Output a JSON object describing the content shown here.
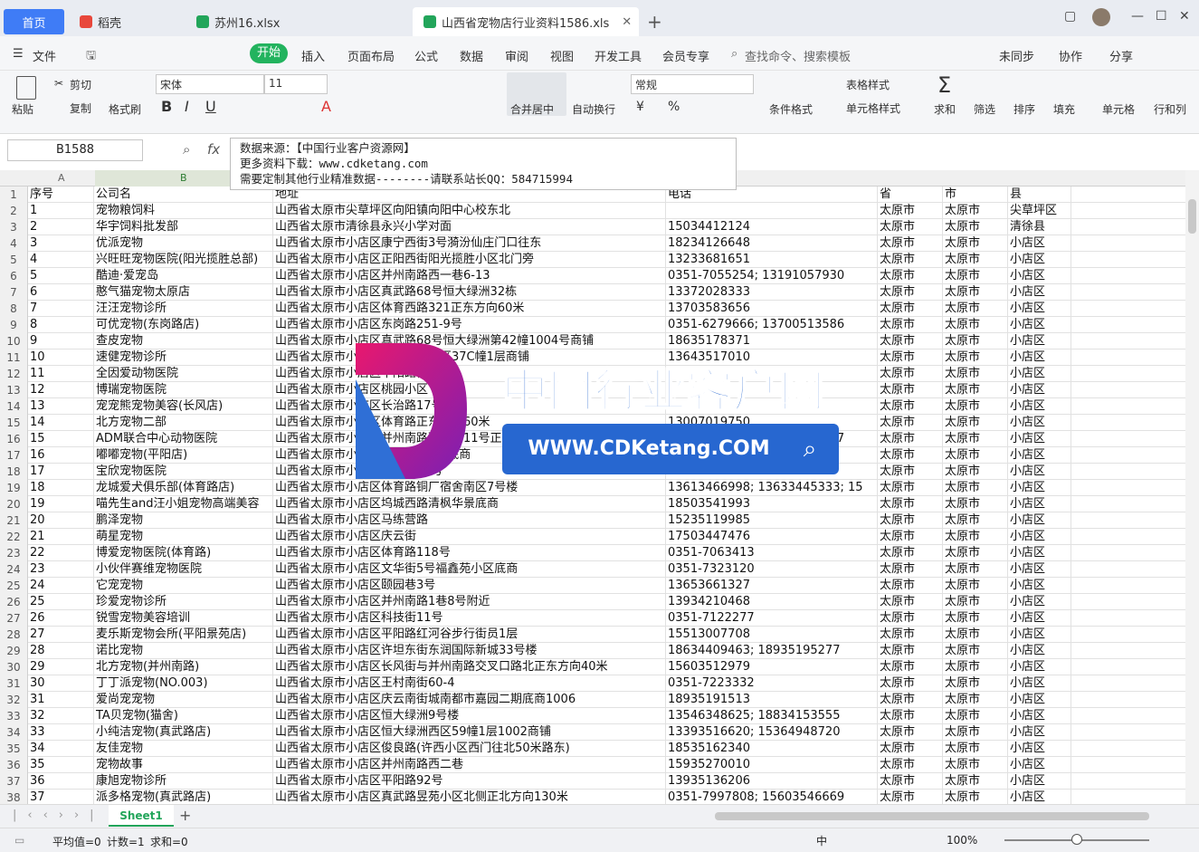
{
  "tabs": {
    "home": "首页",
    "wps": "稻壳",
    "file1": "苏州16.xlsx",
    "file2": "山西省宠物店行业资料1586.xls"
  },
  "menu": {
    "file": "文件",
    "start": "开始",
    "insert": "插入",
    "layout": "页面布局",
    "formula": "公式",
    "data": "数据",
    "review": "审阅",
    "view": "视图",
    "dev": "开发工具",
    "vip": "会员专享",
    "search": "查找命令、搜索模板",
    "sync": "未同步",
    "collab": "协作",
    "share": "分享"
  },
  "ribbon": {
    "paste": "粘贴",
    "cut": "剪切",
    "copy": "复制",
    "format_painter": "格式刷",
    "font": "宋体",
    "size": "11",
    "merge": "合并居中",
    "wrap": "自动换行",
    "numfmt": "常规",
    "cond": "条件格式",
    "tablestyle": "表格样式",
    "cellstyle": "单元格样式",
    "sum": "求和",
    "filter": "筛选",
    "sort": "排序",
    "fill": "填充",
    "cell": "单元格",
    "rowcol": "行和列"
  },
  "namebox": "B1588",
  "formula_lines": [
    "数据来源：【中国行业客户资源网】",
    "更多资料下载：www.cdketang.com",
    "需要定制其他行业精准数据--------请联系站长QQ：584715994"
  ],
  "columns": [
    "A",
    "B"
  ],
  "headers": [
    "序号",
    "公司名",
    "地址",
    "电话",
    "省",
    "市",
    "县"
  ],
  "rows": [
    [
      "1",
      "宠物粮饲料",
      "山西省太原市尖草坪区向阳镇向阳中心校东北",
      "",
      "太原市",
      "太原市",
      "尖草坪区"
    ],
    [
      "2",
      "华宇饲料批发部",
      "山西省太原市清徐县永兴小学对面",
      "15034412124",
      "太原市",
      "太原市",
      "清徐县"
    ],
    [
      "3",
      "优派宠物",
      "山西省太原市小店区康宁西街3号漪汾仙庄门口往东",
      "18234126648",
      "太原市",
      "太原市",
      "小店区"
    ],
    [
      "4",
      "兴旺旺宠物医院(阳光揽胜总部)",
      "山西省太原市小店区正阳西街阳光揽胜小区北门旁",
      "13233681651",
      "太原市",
      "太原市",
      "小店区"
    ],
    [
      "5",
      "酷迪·爱宠岛",
      "山西省太原市小店区并州南路西一巷6-13",
      "0351-7055254; 13191057930",
      "太原市",
      "太原市",
      "小店区"
    ],
    [
      "6",
      "憨气猫宠物太原店",
      "山西省太原市小店区真武路68号恒大绿洲32栋",
      "13372028333",
      "太原市",
      "太原市",
      "小店区"
    ],
    [
      "7",
      "汪汪宠物诊所",
      "山西省太原市小店区体育西路321正东方向60米",
      "13703583656",
      "太原市",
      "太原市",
      "小店区"
    ],
    [
      "8",
      "可优宠物(东岗路店)",
      "山西省太原市小店区东岗路251-9号",
      "0351-6279666; 13700513586",
      "太原市",
      "太原市",
      "小店区"
    ],
    [
      "9",
      "查皮宠物",
      "山西省太原市小店区真武路68号恒大绿洲第42幢1004号商铺",
      "18635178371",
      "太原市",
      "太原市",
      "小店区"
    ],
    [
      "10",
      "速健宠物诊所",
      "山西省太原市小店区恒大绿洲东区37C幢1层商铺",
      "13643517010",
      "太原市",
      "太原市",
      "小店区"
    ],
    [
      "11",
      "全因爱动物医院",
      "山西省太原市小店区平阳路街道",
      "",
      "太原市",
      "太原市",
      "小店区"
    ],
    [
      "12",
      "博瑞宠物医院",
      "山西省太原市小店区桃园小区",
      "",
      "太原市",
      "太原市",
      "小店区"
    ],
    [
      "13",
      "宠宠熊宠物美容(长风店)",
      "山西省太原市小店区长治路17号",
      "",
      "太原市",
      "太原市",
      "小店区"
    ],
    [
      "14",
      "北方宠物二部",
      "山西省太原市小店区体育路正东方向60米",
      "13007019750",
      "太原市",
      "太原市",
      "小店区"
    ],
    [
      "15",
      "ADM联合中心动物医院",
      "山西省太原市小店区并州南路西二巷11号正西方向30米",
      "0351-5611327; 17735123437",
      "太原市",
      "太原市",
      "小店区"
    ],
    [
      "16",
      "嘟嘟宠物(平阳店)",
      "山西省太原市小店区平阳路1号楼底商",
      "",
      "太原市",
      "太原市",
      "小店区"
    ],
    [
      "17",
      "宝欣宠物医院",
      "山西省太原市小店区坞城路25号",
      "13593133348",
      "太原市",
      "太原市",
      "小店区"
    ],
    [
      "18",
      "龙城爱犬俱乐部(体育路店)",
      "山西省太原市小店区体育路铜厂宿舍南区7号楼",
      "13613466998; 13633445333; 15",
      "太原市",
      "太原市",
      "小店区"
    ],
    [
      "19",
      "喵先生and汪小姐宠物高端美容",
      "山西省太原市小店区坞城西路清枫华景底商",
      "18503541993",
      "太原市",
      "太原市",
      "小店区"
    ],
    [
      "20",
      "鹏泽宠物",
      "山西省太原市小店区马练营路",
      "15235119985",
      "太原市",
      "太原市",
      "小店区"
    ],
    [
      "21",
      "萌星宠物",
      "山西省太原市小店区庆云街",
      "17503447476",
      "太原市",
      "太原市",
      "小店区"
    ],
    [
      "22",
      "博爱宠物医院(体育路)",
      "山西省太原市小店区体育路118号",
      "0351-7063413",
      "太原市",
      "太原市",
      "小店区"
    ],
    [
      "23",
      "小伙伴赛维宠物医院",
      "山西省太原市小店区文华街5号福鑫苑小区底商",
      "0351-7323120",
      "太原市",
      "太原市",
      "小店区"
    ],
    [
      "24",
      "它宠宠物",
      "山西省太原市小店区颐园巷3号",
      "13653661327",
      "太原市",
      "太原市",
      "小店区"
    ],
    [
      "25",
      "珍爱宠物诊所",
      "山西省太原市小店区并州南路1巷8号附近",
      "13934210468",
      "太原市",
      "太原市",
      "小店区"
    ],
    [
      "26",
      "锐雪宠物美容培训",
      "山西省太原市小店区科技街11号",
      "0351-7122277",
      "太原市",
      "太原市",
      "小店区"
    ],
    [
      "27",
      "麦乐斯宠物会所(平阳景苑店)",
      "山西省太原市小店区平阳路红河谷步行街员1层",
      "15513007708",
      "太原市",
      "太原市",
      "小店区"
    ],
    [
      "28",
      "诺比宠物",
      "山西省太原市小店区许坦东街东润国际新城33号楼",
      "18634409463; 18935195277",
      "太原市",
      "太原市",
      "小店区"
    ],
    [
      "29",
      "北方宠物(并州南路)",
      "山西省太原市小店区长风街与并州南路交叉口路北正东方向40米",
      "15603512979",
      "太原市",
      "太原市",
      "小店区"
    ],
    [
      "30",
      "丁丁派宠物(NO.003)",
      "山西省太原市小店区王村南街60-4",
      "0351-7223332",
      "太原市",
      "太原市",
      "小店区"
    ],
    [
      "31",
      "爱尚宠宠物",
      "山西省太原市小店区庆云南街城南都市嘉园二期底商1006",
      "18935191513",
      "太原市",
      "太原市",
      "小店区"
    ],
    [
      "32",
      "TA贝宠物(猫舍)",
      "山西省太原市小店区恒大绿洲9号楼",
      "13546348625; 18834153555",
      "太原市",
      "太原市",
      "小店区"
    ],
    [
      "33",
      "小纯洁宠物(真武路店)",
      "山西省太原市小店区恒大绿洲西区59幢1层1002商铺",
      "13393516620; 15364948720",
      "太原市",
      "太原市",
      "小店区"
    ],
    [
      "34",
      "友佳宠物",
      "山西省太原市小店区俊良路(许西小区西门往北50米路东)",
      "18535162340",
      "太原市",
      "太原市",
      "小店区"
    ],
    [
      "35",
      "宠物故事",
      "山西省太原市小店区并州南路西二巷",
      "15935270010",
      "太原市",
      "太原市",
      "小店区"
    ],
    [
      "36",
      "康旭宠物诊所",
      "山西省太原市小店区平阳路92号",
      "13935136206",
      "太原市",
      "太原市",
      "小店区"
    ],
    [
      "37",
      "派多格宠物(真武路店)",
      "山西省太原市小店区真武路昱苑小区北侧正北方向130米",
      "0351-7997808; 15603546669",
      "太原市",
      "太原市",
      "小店区"
    ]
  ],
  "sheet": "Sheet1",
  "status": {
    "avg": "平均值=0",
    "count": "计数=1",
    "sum": "求和=0",
    "zoom": "100%",
    "ime": "中"
  },
  "watermark": {
    "title": "中国行业客户网",
    "url": "WWW.CDKetang.COM"
  }
}
